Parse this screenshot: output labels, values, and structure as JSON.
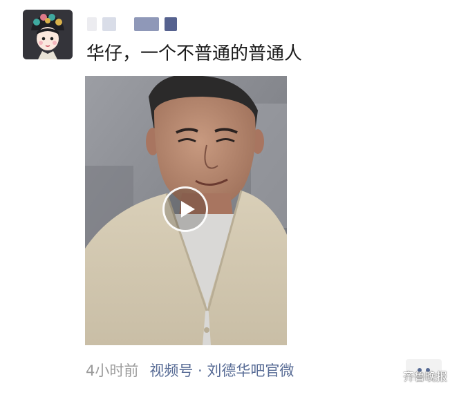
{
  "post": {
    "text": "华仔，一个不普通的普通人",
    "time_ago": "4小时前",
    "source": "视频号 · 刘德华吧官微"
  },
  "video": {
    "play_icon": "play-icon"
  },
  "actions": {
    "more_icon": "more-dots-icon"
  },
  "watermark": {
    "text": "齐鲁晚报",
    "icon": "wechat-icon"
  },
  "colors": {
    "link": "#576b95",
    "muted": "#9b9b9b",
    "text": "#1a1a1a"
  }
}
